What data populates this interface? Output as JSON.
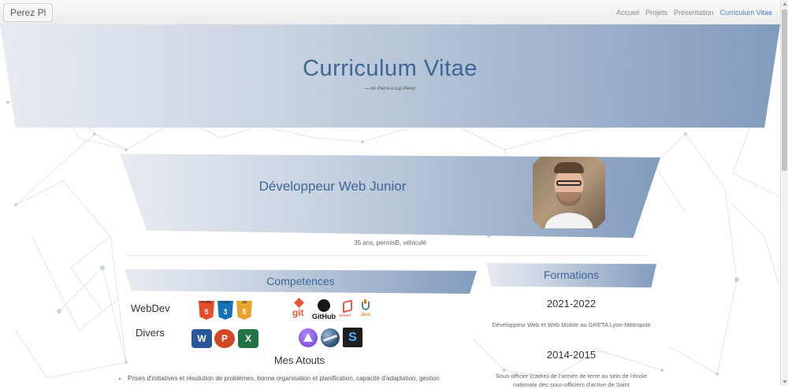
{
  "navbar": {
    "brand": "Perez Pl",
    "links": [
      "Accueil",
      "Projets",
      "Présentation",
      "Curriculum Vitae"
    ],
    "active_link": "Curriculum Vitae",
    "active_color": "#4a7fbd"
  },
  "hero": {
    "title": "Curriculum Vitae",
    "subtitle": "— de Pierre-Loup Perez"
  },
  "profile": {
    "job_title": "Développeur Web Junior",
    "info": "35 ans, permisB, véhiculé"
  },
  "competences": {
    "title": "Competences",
    "webdev_label": "WebDev",
    "divers_label": "Divers",
    "webdev_icons": [
      "html5-icon",
      "css3-icon",
      "js-icon",
      "git-icon",
      "github-icon",
      "laravel-icon",
      "java-icon"
    ],
    "divers_icons": [
      "word-icon",
      "powerpoint-icon",
      "excel-icon",
      "affinity-icon",
      "eclipse-icon",
      "sublime-text-icon"
    ],
    "icon_text": {
      "html": "5",
      "css": "3",
      "js": "5",
      "html_tag": "HTML",
      "css_tag": "CSS",
      "js_tag": "JS",
      "git": "git",
      "github": "GitHub",
      "laravel": "laravel",
      "java": "Java",
      "word": "W",
      "powerpoint": "P",
      "excel": "X",
      "sublime": "S"
    },
    "atouts_title": "Mes Atouts",
    "atouts": [
      "Prises d'initiatives et résolution de problèmes, bonne organisation et planification, capacité d'adaptation, gestion"
    ]
  },
  "formations": {
    "title": "Formations",
    "items": [
      {
        "year": "2021-2022",
        "description": "Développeur Web et Web Mobile au GRETA Lyon-Métropole"
      },
      {
        "year": "2014-2015",
        "description": "Sous-officier (cadre) de l'armée de terre au sein de l'école nationale des sous-officiers d'active de Saint"
      }
    ]
  },
  "colors": {
    "heading": "#3d6796",
    "banner_light": "#e7ebf1",
    "banner_dark": "#7f99bb",
    "html5": "#e44d26",
    "css3": "#1572b6",
    "js": "#e8a42c",
    "word": "#2b579a",
    "powerpoint": "#d24726",
    "excel": "#217346"
  }
}
